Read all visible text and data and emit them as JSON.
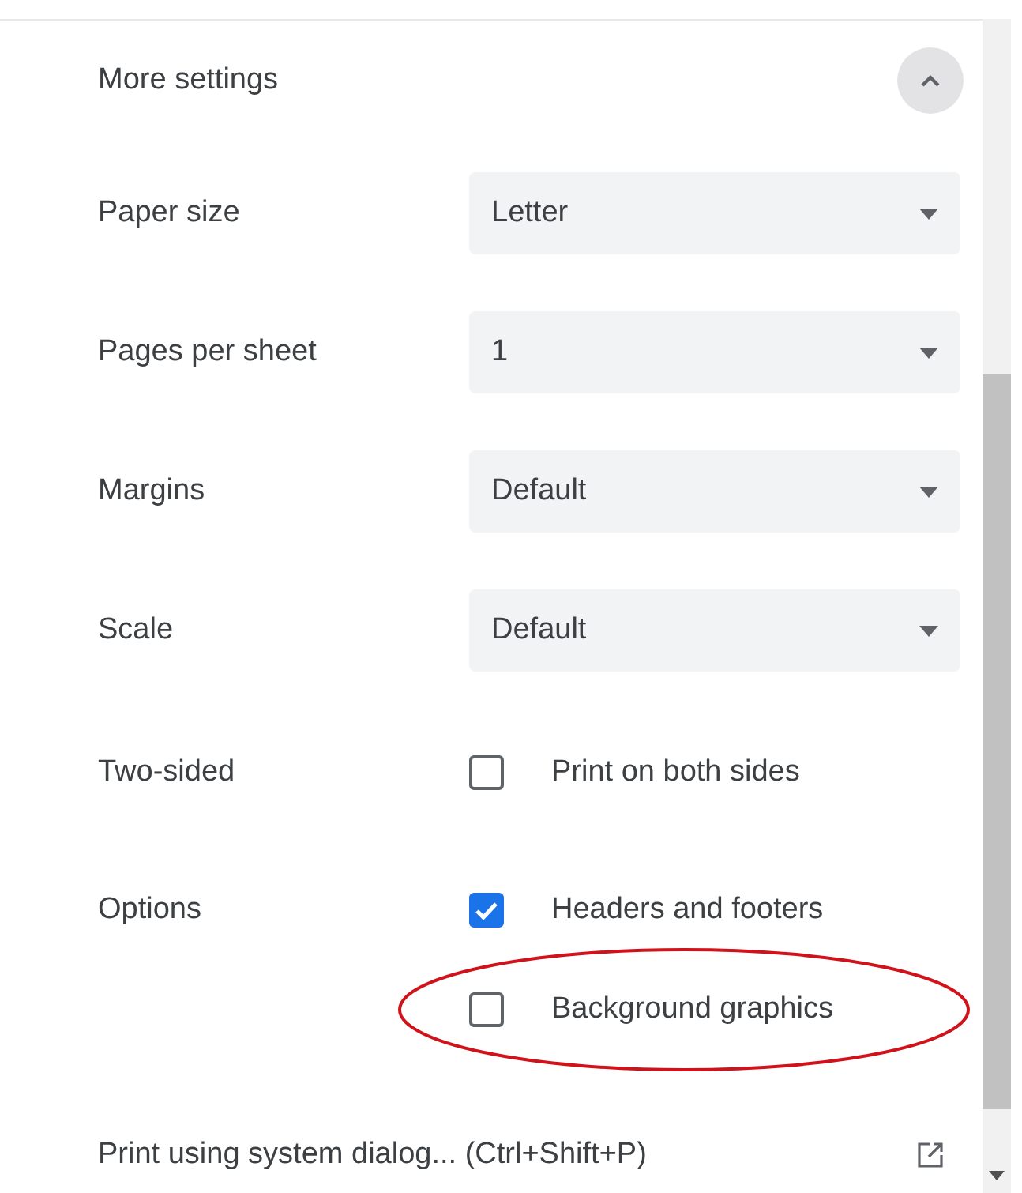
{
  "section": {
    "label": "More settings",
    "expanded": true
  },
  "settings": [
    {
      "kind": "select",
      "label": "Paper size",
      "value": "Letter"
    },
    {
      "kind": "select",
      "label": "Pages per sheet",
      "value": "1"
    },
    {
      "kind": "select",
      "label": "Margins",
      "value": "Default"
    },
    {
      "kind": "select",
      "label": "Scale",
      "value": "Default"
    },
    {
      "kind": "checkboxes",
      "label": "Two-sided",
      "options": [
        {
          "label": "Print on both sides",
          "checked": false,
          "circled": false
        }
      ]
    },
    {
      "kind": "checkboxes",
      "label": "Options",
      "options": [
        {
          "label": "Headers and footers",
          "checked": true,
          "circled": false
        },
        {
          "label": "Background graphics",
          "checked": false,
          "circled": true
        }
      ]
    }
  ],
  "system_dialog_link": {
    "label": "Print using system dialog... (Ctrl+Shift+P)"
  }
}
